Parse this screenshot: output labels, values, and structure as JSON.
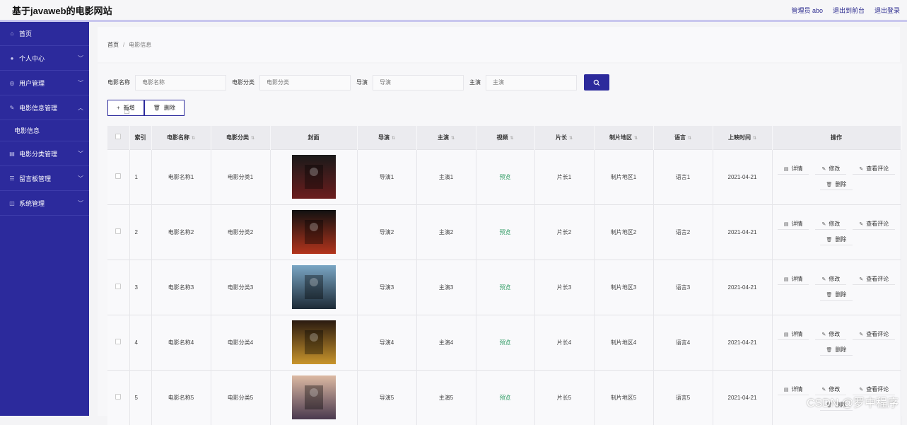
{
  "app": {
    "title": "基于javaweb的电影网站",
    "user_label": "管理员 abo",
    "back_label": "退出到前台",
    "logout_label": "退出登录"
  },
  "sidebar": {
    "items": [
      {
        "label": "首页",
        "icon": "home-icon"
      },
      {
        "label": "个人中心",
        "icon": "user-icon"
      },
      {
        "label": "用户管理",
        "icon": "users-icon"
      },
      {
        "label": "电影信息管理",
        "icon": "film-icon"
      },
      {
        "label": "电影信息",
        "icon": ""
      },
      {
        "label": "电影分类管理",
        "icon": "category-icon"
      },
      {
        "label": "留言板管理",
        "icon": "message-icon"
      },
      {
        "label": "系统管理",
        "icon": "settings-icon"
      }
    ]
  },
  "breadcrumb": {
    "home": "首页",
    "current": "电影信息"
  },
  "search": {
    "name_label": "电影名称",
    "name_placeholder": "电影名称",
    "category_label": "电影分类",
    "category_placeholder": "电影分类",
    "director_label": "导演",
    "director_placeholder": "导演",
    "actor_label": "主演",
    "actor_placeholder": "主演"
  },
  "actions": {
    "add_label": "新增",
    "delete_label": "删除"
  },
  "table": {
    "headers": [
      "索引",
      "电影名称",
      "电影分类",
      "封面",
      "导演",
      "主演",
      "视频",
      "片长",
      "制片地区",
      "语言",
      "上映时间",
      "操作"
    ],
    "rows": [
      {
        "index": "1",
        "name": "电影名称1",
        "category": "电影分类1",
        "director": "导演1",
        "actor": "主演1",
        "video": "预览",
        "length": "片长1",
        "region": "制片地区1",
        "language": "语言1",
        "date": "2021-04-21",
        "poster_colors": [
          "#1a1a1a",
          "#6b1d1d"
        ]
      },
      {
        "index": "2",
        "name": "电影名称2",
        "category": "电影分类2",
        "director": "导演2",
        "actor": "主演2",
        "video": "预览",
        "length": "片长2",
        "region": "制片地区2",
        "language": "语言2",
        "date": "2021-04-21",
        "poster_colors": [
          "#111111",
          "#b3341c"
        ]
      },
      {
        "index": "3",
        "name": "电影名称3",
        "category": "电影分类3",
        "director": "导演3",
        "actor": "主演3",
        "video": "预览",
        "length": "片长3",
        "region": "制片地区3",
        "language": "语言3",
        "date": "2021-04-21",
        "poster_colors": [
          "#7aa6c4",
          "#1d2a36"
        ]
      },
      {
        "index": "4",
        "name": "电影名称4",
        "category": "电影分类4",
        "director": "导演4",
        "actor": "主演4",
        "video": "预览",
        "length": "片长4",
        "region": "制片地区4",
        "language": "语言4",
        "date": "2021-04-21",
        "poster_colors": [
          "#2a1a10",
          "#c9952c"
        ]
      },
      {
        "index": "5",
        "name": "电影名称5",
        "category": "电影分类5",
        "director": "导演5",
        "actor": "主演5",
        "video": "预览",
        "length": "片长5",
        "region": "制片地区5",
        "language": "语言5",
        "date": "2021-04-21",
        "poster_colors": [
          "#dcb9a3",
          "#4a3a4f"
        ]
      }
    ],
    "ops": {
      "detail": "详情",
      "edit": "修改",
      "comments": "查看评论",
      "delete": "删除"
    }
  },
  "watermark": "CSDN @罗中程序",
  "colors": {
    "sidebar": "#2c2a9c",
    "accent": "#2c2a9c",
    "preview": "#2e9b63"
  }
}
